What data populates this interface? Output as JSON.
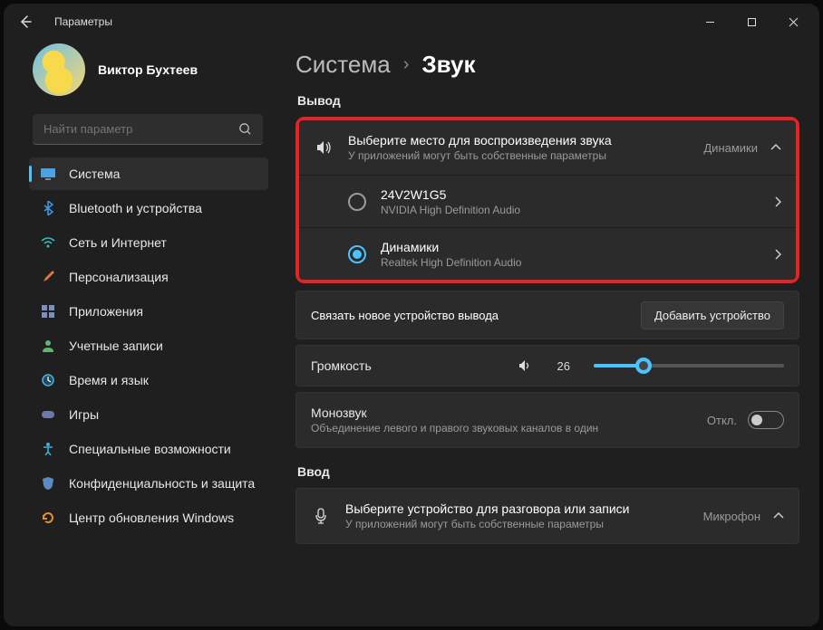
{
  "window": {
    "title": "Параметры"
  },
  "profile": {
    "name": "Виктор Бухтеев",
    "sub": ""
  },
  "search": {
    "placeholder": "Найти параметр"
  },
  "nav": {
    "items": [
      {
        "label": "Система",
        "active": true
      },
      {
        "label": "Bluetooth и устройства"
      },
      {
        "label": "Сеть и Интернет"
      },
      {
        "label": "Персонализация"
      },
      {
        "label": "Приложения"
      },
      {
        "label": "Учетные записи"
      },
      {
        "label": "Время и язык"
      },
      {
        "label": "Игры"
      },
      {
        "label": "Специальные возможности"
      },
      {
        "label": "Конфиденциальность и защита"
      },
      {
        "label": "Центр обновления Windows"
      }
    ]
  },
  "breadcrumb": {
    "root": "Система",
    "current": "Звук"
  },
  "sections": {
    "output": {
      "title": "Вывод",
      "select_device": {
        "title": "Выберите место для воспроизведения звука",
        "sub": "У приложений могут быть собственные параметры",
        "right": "Динамики"
      },
      "devices": [
        {
          "name": "24V2W1G5",
          "sub": "NVIDIA High Definition Audio",
          "selected": false
        },
        {
          "name": "Динамики",
          "sub": "Realtek High Definition Audio",
          "selected": true
        }
      ],
      "link": {
        "label": "Связать новое устройство вывода",
        "button": "Добавить устройство"
      },
      "volume": {
        "label": "Громкость",
        "value": "26"
      },
      "mono": {
        "title": "Монозвук",
        "sub": "Объединение левого и правого звуковых каналов в один",
        "state": "Откл."
      }
    },
    "input": {
      "title": "Ввод",
      "select_device": {
        "title": "Выберите устройство для разговора или записи",
        "sub": "У приложений могут быть собственные параметры",
        "right": "Микрофон"
      }
    }
  }
}
